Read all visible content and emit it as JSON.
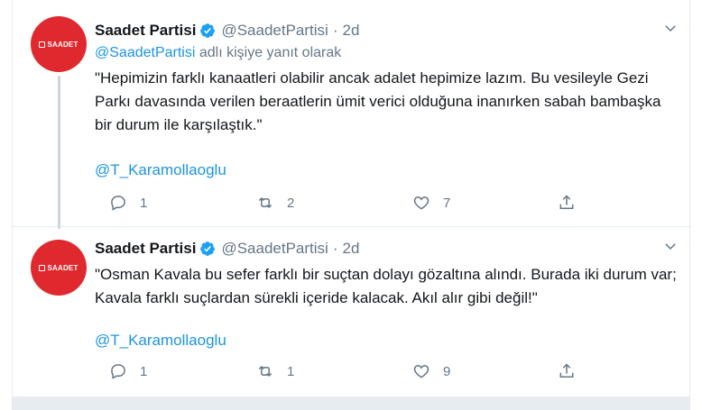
{
  "tweets": [
    {
      "author_name": "Saadet Partisi",
      "handle": "@SaadetPartisi",
      "separator": "·",
      "time": "2d",
      "avatar_text": "SAADET",
      "replying_mention": "@SaadetPartisi",
      "replying_text": " adlı kişiye yanıt olarak",
      "text": "\"Hepimizin farklı kanaatleri olabilir ancak adalet hepimize lazım. Bu vesileyle Gezi Parkı davasında verilen beraatlerin ümit verici olduğuna inanırken sabah bambaşka bir durum ile karşılaştık.\"",
      "tag": "@T_Karamollaoglu",
      "reply_count": "1",
      "retweet_count": "2",
      "like_count": "7"
    },
    {
      "author_name": "Saadet Partisi",
      "handle": "@SaadetPartisi",
      "separator": "·",
      "time": "2d",
      "avatar_text": "SAADET",
      "text": "\"Osman Kavala bu sefer farklı bir suçtan dolayı gözaltına alındı. Burada iki durum var; Kavala farklı suçlardan sürekli içeride kalacak. Akıl alır gibi değil!\"",
      "tag": "@T_Karamollaoglu",
      "reply_count": "1",
      "retweet_count": "1",
      "like_count": "9"
    }
  ],
  "icons": [
    "verified-icon",
    "chevron-down-icon",
    "reply-icon",
    "retweet-icon",
    "like-icon",
    "share-icon"
  ],
  "colors": {
    "accent": "#1b95e0",
    "avatar_red": "#e0292e",
    "muted": "#657786",
    "thread_line": "#ccd6dd"
  }
}
